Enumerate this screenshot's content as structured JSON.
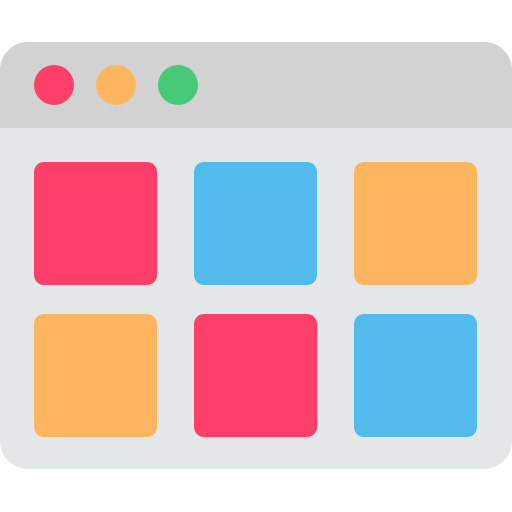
{
  "colors": {
    "window_body": "#e4e7e8",
    "titlebar": "#d2d2d2",
    "red": "#fd3f69",
    "yellow": "#fdb65f",
    "green": "#48c979",
    "blue": "#52bbeb"
  },
  "window_controls": [
    {
      "name": "close-dot",
      "color": "#fd3f69"
    },
    {
      "name": "minimize-dot",
      "color": "#fdb65f"
    },
    {
      "name": "maximize-dot",
      "color": "#48c979"
    }
  ],
  "grid": {
    "rows": 2,
    "columns": 3,
    "tiles": [
      {
        "color": "#fd3f69"
      },
      {
        "color": "#52bbeb"
      },
      {
        "color": "#fdb65f"
      },
      {
        "color": "#fdb65f"
      },
      {
        "color": "#fd3f69"
      },
      {
        "color": "#52bbeb"
      }
    ]
  }
}
